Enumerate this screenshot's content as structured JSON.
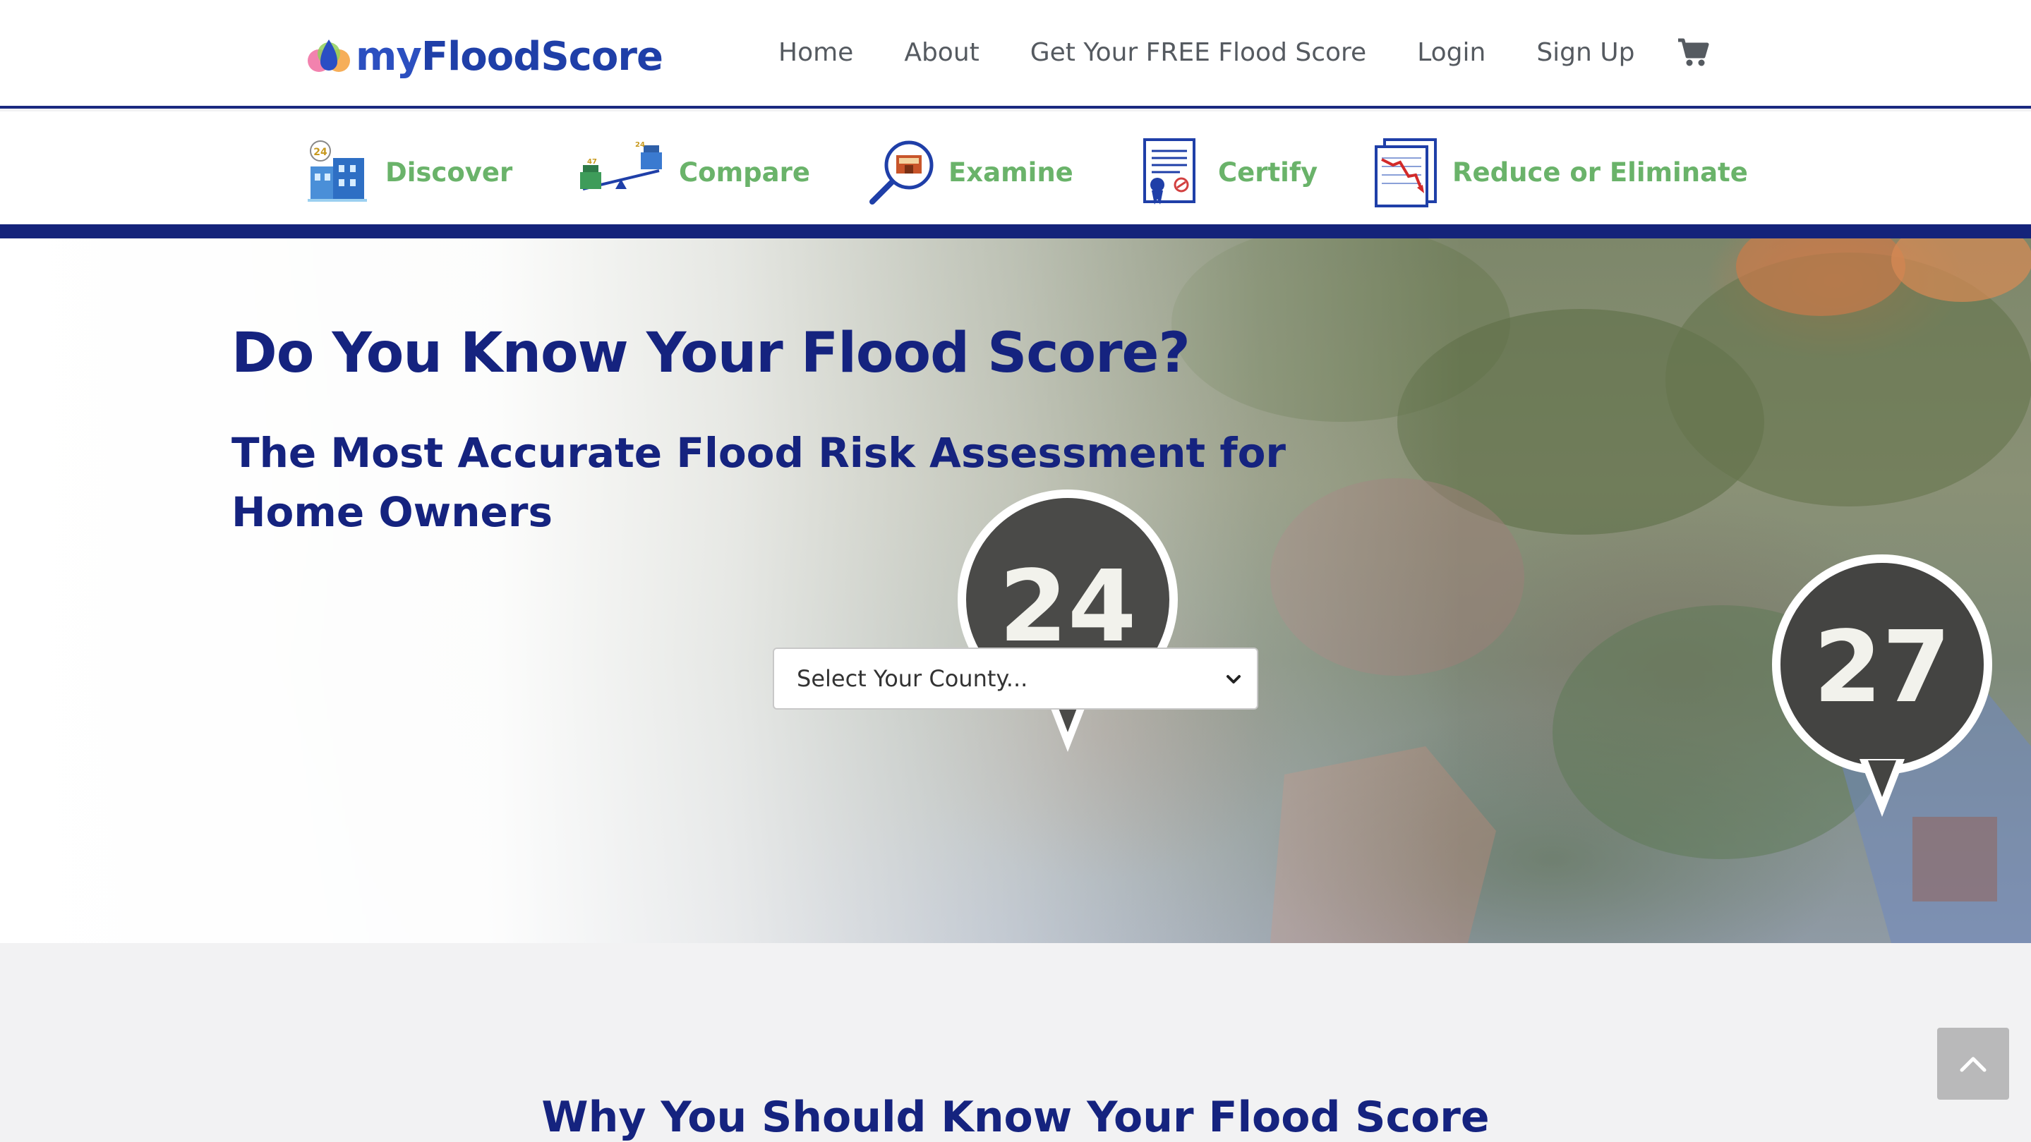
{
  "header": {
    "logo": {
      "my": "my",
      "flood_score": "FloodScore"
    },
    "nav": [
      "Home",
      "About",
      "Get Your FREE Flood Score",
      "Login",
      "Sign Up"
    ],
    "cart_icon": "shopping-cart-icon"
  },
  "features": [
    {
      "label": "Discover",
      "icon": "discover-icon"
    },
    {
      "label": "Compare",
      "icon": "compare-scale-icon"
    },
    {
      "label": "Examine",
      "icon": "magnifier-icon"
    },
    {
      "label": "Certify",
      "icon": "certificate-icon"
    },
    {
      "label": "Reduce or Eliminate",
      "icon": "declining-chart-icon"
    }
  ],
  "hero": {
    "title": "Do You Know Your Flood Score?",
    "subtitle": "The Most Accurate Flood Risk Assessment for Home Owners",
    "pin_scores": [
      "24",
      "27"
    ],
    "county_select": {
      "selected": "Select Your County..."
    }
  },
  "section2": {
    "title": "Why You Should Know Your Flood Score"
  },
  "back_to_top": {
    "icon": "chevron-up-icon"
  },
  "colors": {
    "navy": "#15237f",
    "green": "#6ab36a",
    "nav_text": "#555a60",
    "brand_blue": "#1f3fa8"
  }
}
